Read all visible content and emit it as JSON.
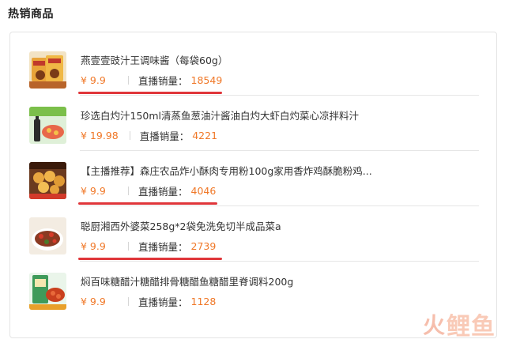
{
  "section": {
    "title": "热销商品"
  },
  "products": [
    {
      "name": "燕壹壹豉汁王调味酱（每袋60g）",
      "price": "¥ 9.9",
      "sales_label": "直播销量：",
      "sales_value": "18549",
      "thumb_icon": "sauce-packet-image"
    },
    {
      "name": "珍选白灼汁150ml清蒸鱼葱油汁酱油白灼大虾白灼菜心凉拌料汁",
      "price": "¥ 19.98",
      "sales_label": "直播销量：",
      "sales_value": "4221",
      "thumb_icon": "sauce-bottle-image"
    },
    {
      "name": "【主播推荐】森庄农品炸小酥肉专用粉100g家用香炸鸡酥脆粉鸡...",
      "price": "¥ 9.9",
      "sales_label": "直播销量：",
      "sales_value": "4046",
      "thumb_icon": "fried-pork-image"
    },
    {
      "name": "聪厨湘西外婆菜258g*2袋免洗免切半成品菜a",
      "price": "¥ 9.9",
      "sales_label": "直播销量：",
      "sales_value": "2739",
      "thumb_icon": "pickled-vegetable-image"
    },
    {
      "name": "焖百味糖醋汁糖醋排骨糖醋鱼糖醋里脊调料200g",
      "price": "¥ 9.9",
      "sales_label": "直播销量：",
      "sales_value": "1128",
      "thumb_icon": "sweet-sour-sauce-image"
    }
  ],
  "watermark": {
    "symbol": "火",
    "text": "鲤鱼"
  },
  "colors": {
    "price": "#f07828",
    "underline": "#e0363a",
    "border": "#e4e4e4"
  }
}
